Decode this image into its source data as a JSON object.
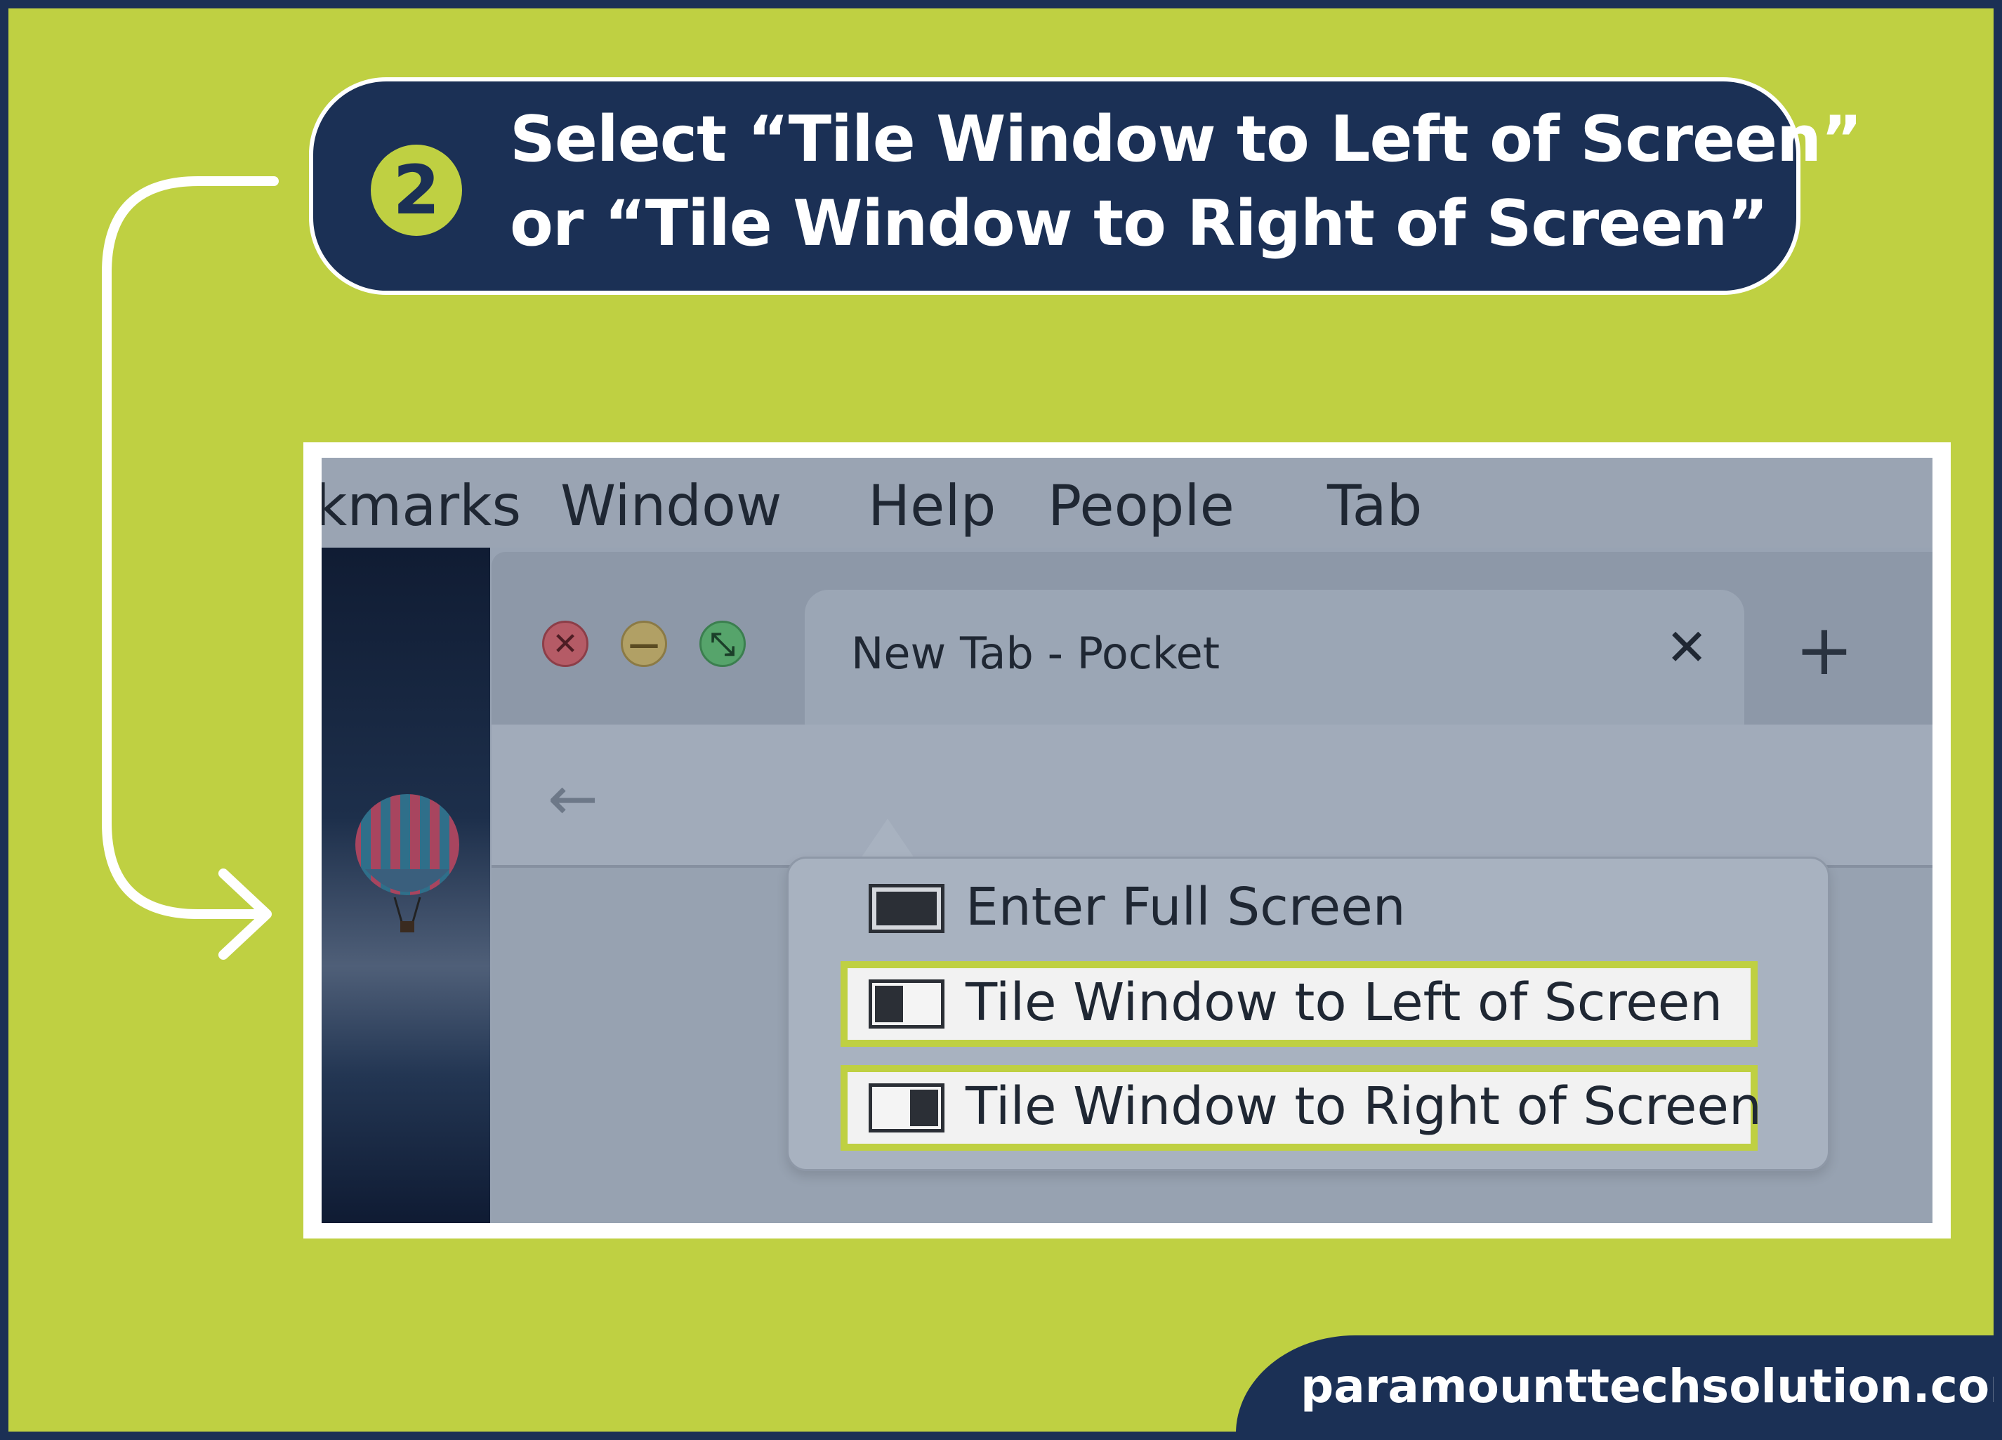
{
  "step": {
    "number": "2",
    "line1": "Select “Tile Window to Left of Screen”",
    "line2": "or “Tile Window to Right of Screen”"
  },
  "menubar": {
    "items": [
      "kmarks",
      "Window",
      "Help",
      "People",
      "Tab"
    ]
  },
  "browser": {
    "tab_title": "New Tab - Pocket",
    "tab_close_glyph": "✕",
    "new_tab_glyph": "+",
    "back_glyph": "←",
    "close_glyph": "✕",
    "minimize_glyph": "—",
    "zoom_glyph": "⤡"
  },
  "popover": {
    "items": [
      {
        "label": "Enter Full Screen",
        "icon": "fullscreen-icon",
        "highlighted": false
      },
      {
        "label": "Tile Window to Left of Screen",
        "icon": "tile-left-icon",
        "highlighted": true
      },
      {
        "label": "Tile Window to Right of Screen",
        "icon": "tile-right-icon",
        "highlighted": true
      }
    ]
  },
  "footer": {
    "url": "paramounttechsolution.com"
  },
  "colors": {
    "background": "#bfd042",
    "navy": "#1b3055",
    "highlight_border": "#bfd042",
    "white": "#ffffff"
  }
}
